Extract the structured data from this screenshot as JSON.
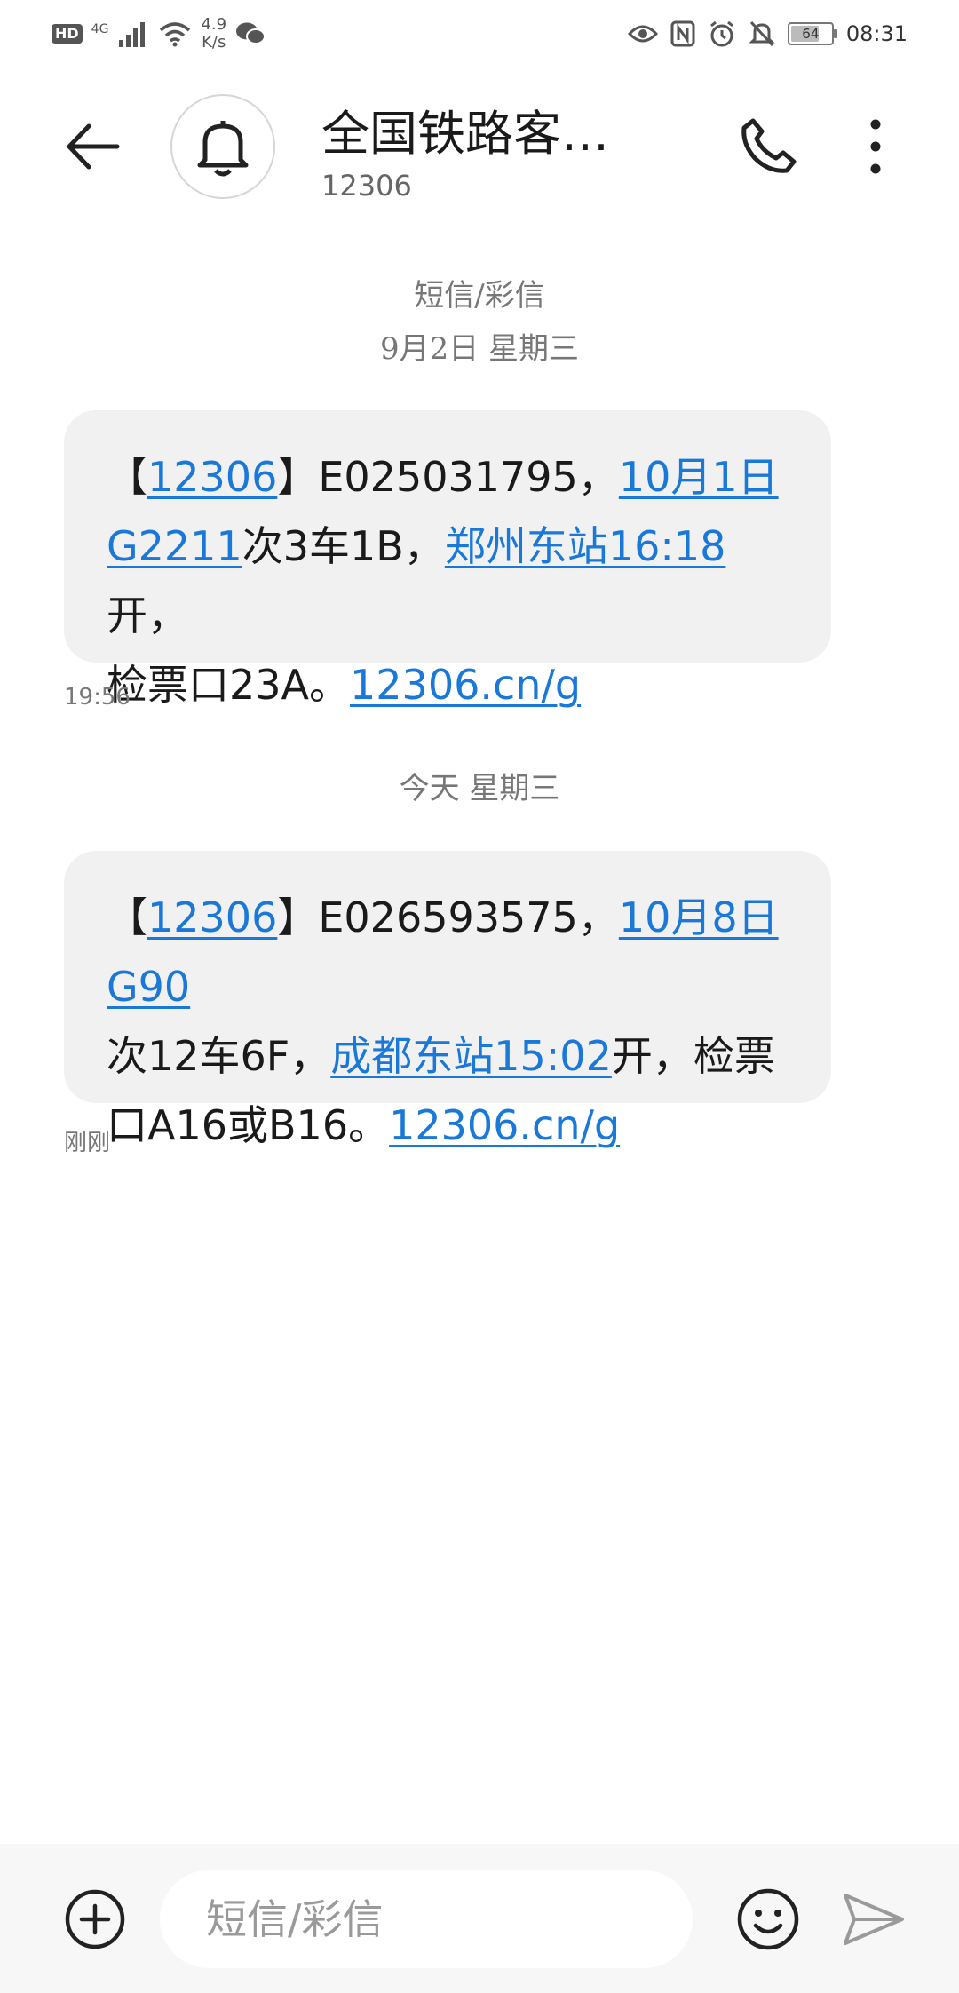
{
  "status_bar": {
    "hd": "HD",
    "network": "4G",
    "speed_value": "4.9",
    "speed_unit": "K/s",
    "battery": "64",
    "time": "08:31",
    "icons": [
      "signal-icon",
      "wifi-icon",
      "wechat-icon",
      "eye-icon",
      "nfc-icon",
      "alarm-icon",
      "mute-icon",
      "battery-icon"
    ]
  },
  "header": {
    "contact_name": "全国铁路客…",
    "contact_number": "12306",
    "icons": [
      "back-arrow-icon",
      "bell-icon",
      "phone-icon",
      "more-vertical-icon"
    ]
  },
  "thread": {
    "channel_label": "短信/彩信",
    "date_label_1": "9月2日 星期三",
    "message_1": {
      "bracket_open": "【",
      "sender_link": "12306",
      "bracket_close": "】",
      "order_no": "E025031795，",
      "date_link": "10月1日",
      "train_link": "G2211",
      "seat": "次3车1B，",
      "station_link": "郑州东站16:18",
      "depart": "开，",
      "gate": "检票口23A。",
      "url_link": "12306.cn/g",
      "time": "19:56"
    },
    "date_label_2": "今天 星期三",
    "message_2": {
      "bracket_open": "【",
      "sender_link": "12306",
      "bracket_close": "】",
      "order_no": "E026593575，",
      "date_train_link": "10月8日G90",
      "seat": "次12车6F，",
      "station_link": "成都东站15:02",
      "depart": "开，检票口A16或B16。",
      "url_link": "12306.cn/g",
      "time": "刚刚"
    }
  },
  "compose": {
    "placeholder": "短信/彩信",
    "icons": [
      "add-icon",
      "emoji-icon",
      "send-icon"
    ]
  },
  "colors": {
    "link": "#1a78d8",
    "bubble": "#f1f1f1",
    "compose_bar": "#f7f7f7"
  }
}
